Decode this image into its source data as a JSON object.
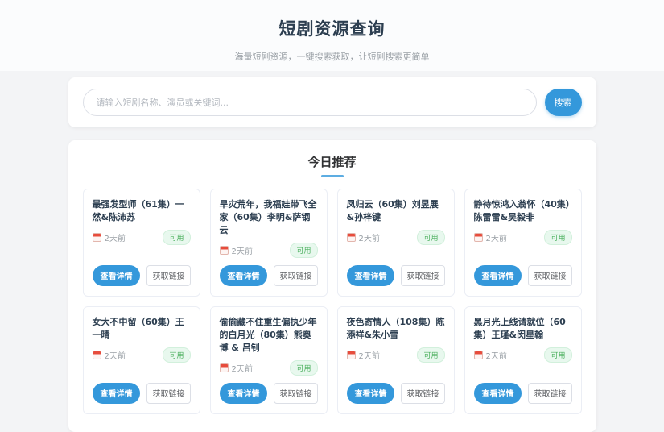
{
  "page": {
    "title": "短剧资源查询",
    "subtitle": "海量短剧资源，一键搜索获取，让短剧搜索更简单"
  },
  "search": {
    "placeholder": "请输入短剧名称、演员或关键词...",
    "button_label": "搜索"
  },
  "recommendations": {
    "heading": "今日推荐",
    "buttons": {
      "detail": "查看详情",
      "link": "获取链接"
    },
    "cards": [
      {
        "title": "最强发型师（61集）一然&陈沛苏",
        "time": "2天前",
        "status": "可用"
      },
      {
        "title": "旱灾荒年，我福娃带飞全家（60集）李明&萨钢云",
        "time": "2天前",
        "status": "可用"
      },
      {
        "title": "凤归云（60集）刘昱展&孙梓键",
        "time": "2天前",
        "status": "可用"
      },
      {
        "title": "静待惊鸿入翁怀（40集）陈雷雷&吴毅非",
        "time": "2天前",
        "status": "可用"
      },
      {
        "title": "女大不中留（60集）王一晴",
        "time": "2天前",
        "status": "可用"
      },
      {
        "title": "偷偷藏不住重生偏执少年的白月光（80集）熊奥博 & 吕钊",
        "time": "2天前",
        "status": "可用"
      },
      {
        "title": "夜色寄情人（108集）陈添祥&朱小雪",
        "time": "2天前",
        "status": "可用"
      },
      {
        "title": "黑月光上线请就位（60集）王瑾&闵星翰",
        "time": "2天前",
        "status": "可用"
      }
    ]
  },
  "colors": {
    "accent": "#3498db",
    "badge_bg": "#e8f8ee",
    "badge_text": "#4cb05e",
    "calendar_red": "#e74c3c"
  }
}
